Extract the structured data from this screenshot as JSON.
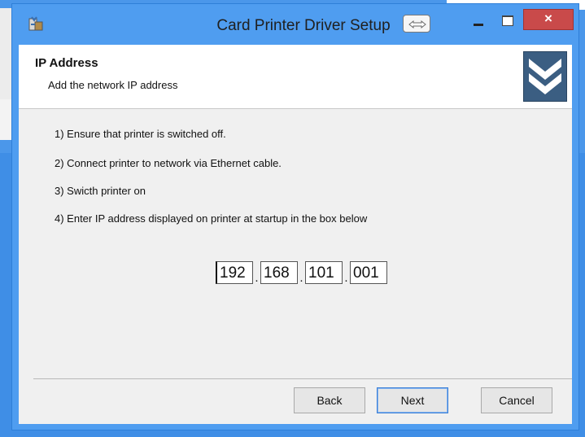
{
  "window": {
    "title": "Card Printer Driver Setup",
    "close_glyph": "×"
  },
  "header": {
    "title": "IP Address",
    "subtitle": "Add the network IP address"
  },
  "steps": [
    "1) Ensure that printer is switched off.",
    "2) Connect printer to network via Ethernet cable.",
    "3) Swicth printer on",
    "4) Enter IP address displayed on printer at startup in the box below"
  ],
  "ip_address": {
    "octets": [
      "192",
      "168",
      "101",
      "001"
    ],
    "separator": "."
  },
  "buttons": {
    "back": "Back",
    "next": "Next",
    "cancel": "Cancel"
  },
  "icons": {
    "app": "installer-icon",
    "resize": "resize-arrows-icon",
    "logo": "double-chevron-down-icon"
  },
  "colors": {
    "desktop": "#3f8ee6",
    "close_button": "#c94a4a",
    "logo_background": "#3b5e82"
  }
}
